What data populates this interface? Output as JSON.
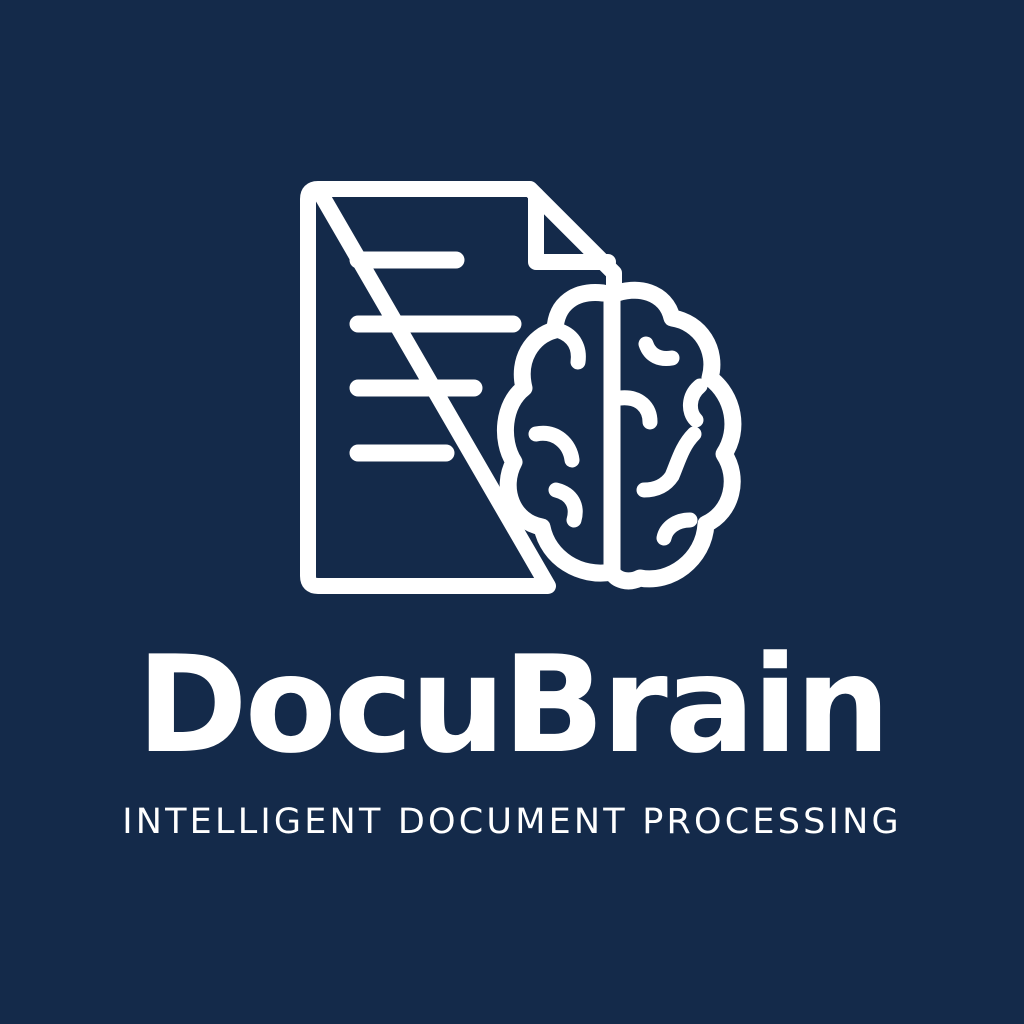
{
  "brand": {
    "name": "DocuBrain",
    "tagline": "INTELLIGENT DOCUMENT PROCESSING"
  },
  "icons": {
    "mark": "document-brain-icon"
  },
  "colors": {
    "background": "#142a4a",
    "foreground": "#ffffff"
  }
}
